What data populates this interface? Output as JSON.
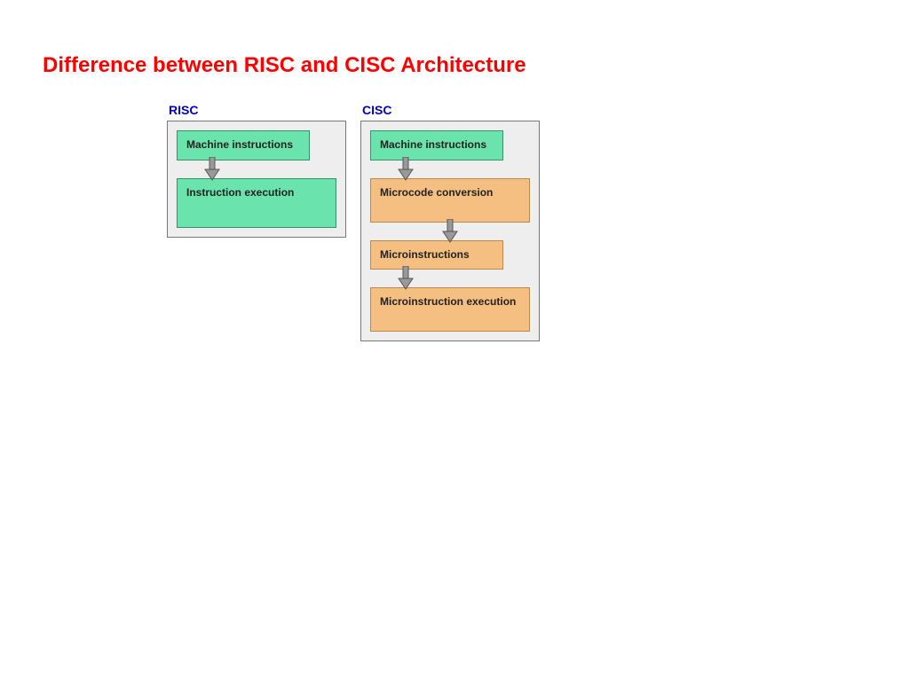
{
  "title": "Difference between RISC and CISC Architecture",
  "risc": {
    "label": "RISC",
    "steps": [
      "Machine instructions",
      "Instruction execution"
    ]
  },
  "cisc": {
    "label": "CISC",
    "steps": [
      "Machine instructions",
      "Microcode conversion",
      "Microinstructions",
      "Microinstruction execution"
    ]
  }
}
